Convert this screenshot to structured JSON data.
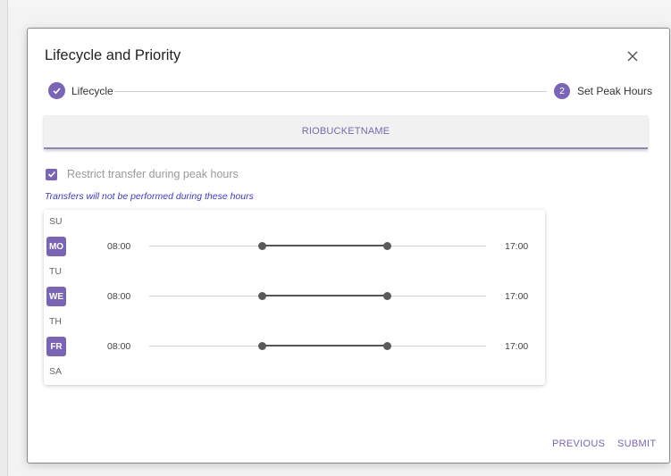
{
  "dialog": {
    "title": "Lifecycle and Priority",
    "close_icon": "close-icon"
  },
  "stepper": {
    "steps": [
      {
        "label": "Lifecycle",
        "state": "completed",
        "icon": "check-icon"
      },
      {
        "number": "2",
        "label": "Set Peak Hours",
        "state": "active"
      }
    ]
  },
  "bucket_tab": {
    "label": "RIOBUCKETNAME"
  },
  "restrict": {
    "label": "Restrict transfer during peak hours",
    "checked": true
  },
  "hint": "Transfers will not be performed during these hours",
  "schedule": {
    "days": [
      {
        "label": "SU",
        "selected": false
      },
      {
        "label": "MO",
        "selected": true,
        "start": "08:00",
        "end": "17:00"
      },
      {
        "label": "TU",
        "selected": false
      },
      {
        "label": "WE",
        "selected": true,
        "start": "08:00",
        "end": "17:00"
      },
      {
        "label": "TH",
        "selected": false
      },
      {
        "label": "FR",
        "selected": true,
        "start": "08:00",
        "end": "17:00"
      },
      {
        "label": "SA",
        "selected": false
      }
    ]
  },
  "footer": {
    "previous_label": "PREVIOUS",
    "submit_label": "SUBMIT"
  },
  "colors": {
    "accent": "#7a64b5",
    "hint_text": "#3b3bc2"
  }
}
